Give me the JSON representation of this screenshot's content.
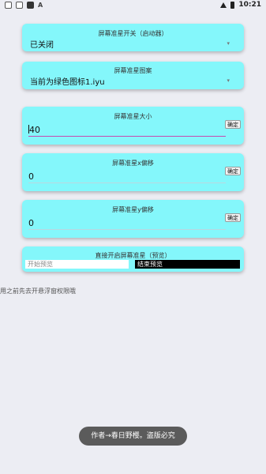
{
  "status_bar": {
    "notification_icons": [
      "square-icon",
      "square-icon",
      "square-dark-icon"
    ],
    "app_letter": "A",
    "time": "10:21"
  },
  "cards": {
    "crosshair_toggle": {
      "title": "屏幕准星开关（启动器）",
      "value": "已关闭"
    },
    "crosshair_icon": {
      "title": "屏幕准星图案",
      "value": "当前为绿色图标1.iyu"
    },
    "crosshair_size": {
      "title": "屏幕准星大小",
      "value": "40",
      "confirm_label": "确定"
    },
    "x_offset": {
      "title": "屏幕准星x偏移",
      "value": "0",
      "confirm_label": "确定"
    },
    "y_offset": {
      "title": "屏幕准星y偏移",
      "value": "0",
      "confirm_label": "确定"
    },
    "preview": {
      "title": "直接开启屏幕准星（预览）",
      "start_label": "开始预览",
      "end_label": "结束预览"
    }
  },
  "note": "用之前先去开悬浮窗权限哦",
  "toast": "作者→春日野樱。盗版必究",
  "colors": {
    "card_bg": "#84f7fb",
    "page_bg": "#ecedf3",
    "focus_underline": "#c64bb0"
  }
}
